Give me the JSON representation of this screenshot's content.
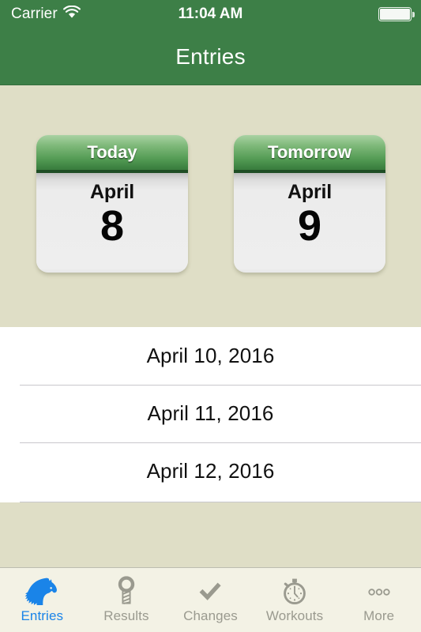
{
  "status_bar": {
    "carrier": "Carrier",
    "wifi_icon": "wifi-icon",
    "time": "11:04 AM",
    "battery_icon": "battery-full-icon"
  },
  "nav_bar": {
    "title": "Entries"
  },
  "theme": {
    "nav_green": "#3d7f47",
    "background_beige": "#dfdec6",
    "tabbar_cream": "#f3f2e5",
    "active_tab_blue": "#1a84e8",
    "inactive_tab_gray": "#9a9a8f",
    "card_body_gray": "#eeeeee",
    "separator_gray": "#c8c7cc"
  },
  "cards": [
    {
      "header": "Today",
      "month": "April",
      "day": "8"
    },
    {
      "header": "Tomorrow",
      "month": "April",
      "day": "9"
    }
  ],
  "list": {
    "rows": [
      {
        "label": "April 10, 2016"
      },
      {
        "label": "April 11, 2016"
      },
      {
        "label": "April 12, 2016"
      }
    ]
  },
  "tab_bar": {
    "tabs": [
      {
        "label": "Entries",
        "icon": "horse-head-icon",
        "active": true
      },
      {
        "label": "Results",
        "icon": "winning-post-icon",
        "active": false
      },
      {
        "label": "Changes",
        "icon": "checkmark-icon",
        "active": false
      },
      {
        "label": "Workouts",
        "icon": "stopwatch-icon",
        "active": false
      },
      {
        "label": "More",
        "icon": "three-dots-icon",
        "active": false
      }
    ]
  }
}
